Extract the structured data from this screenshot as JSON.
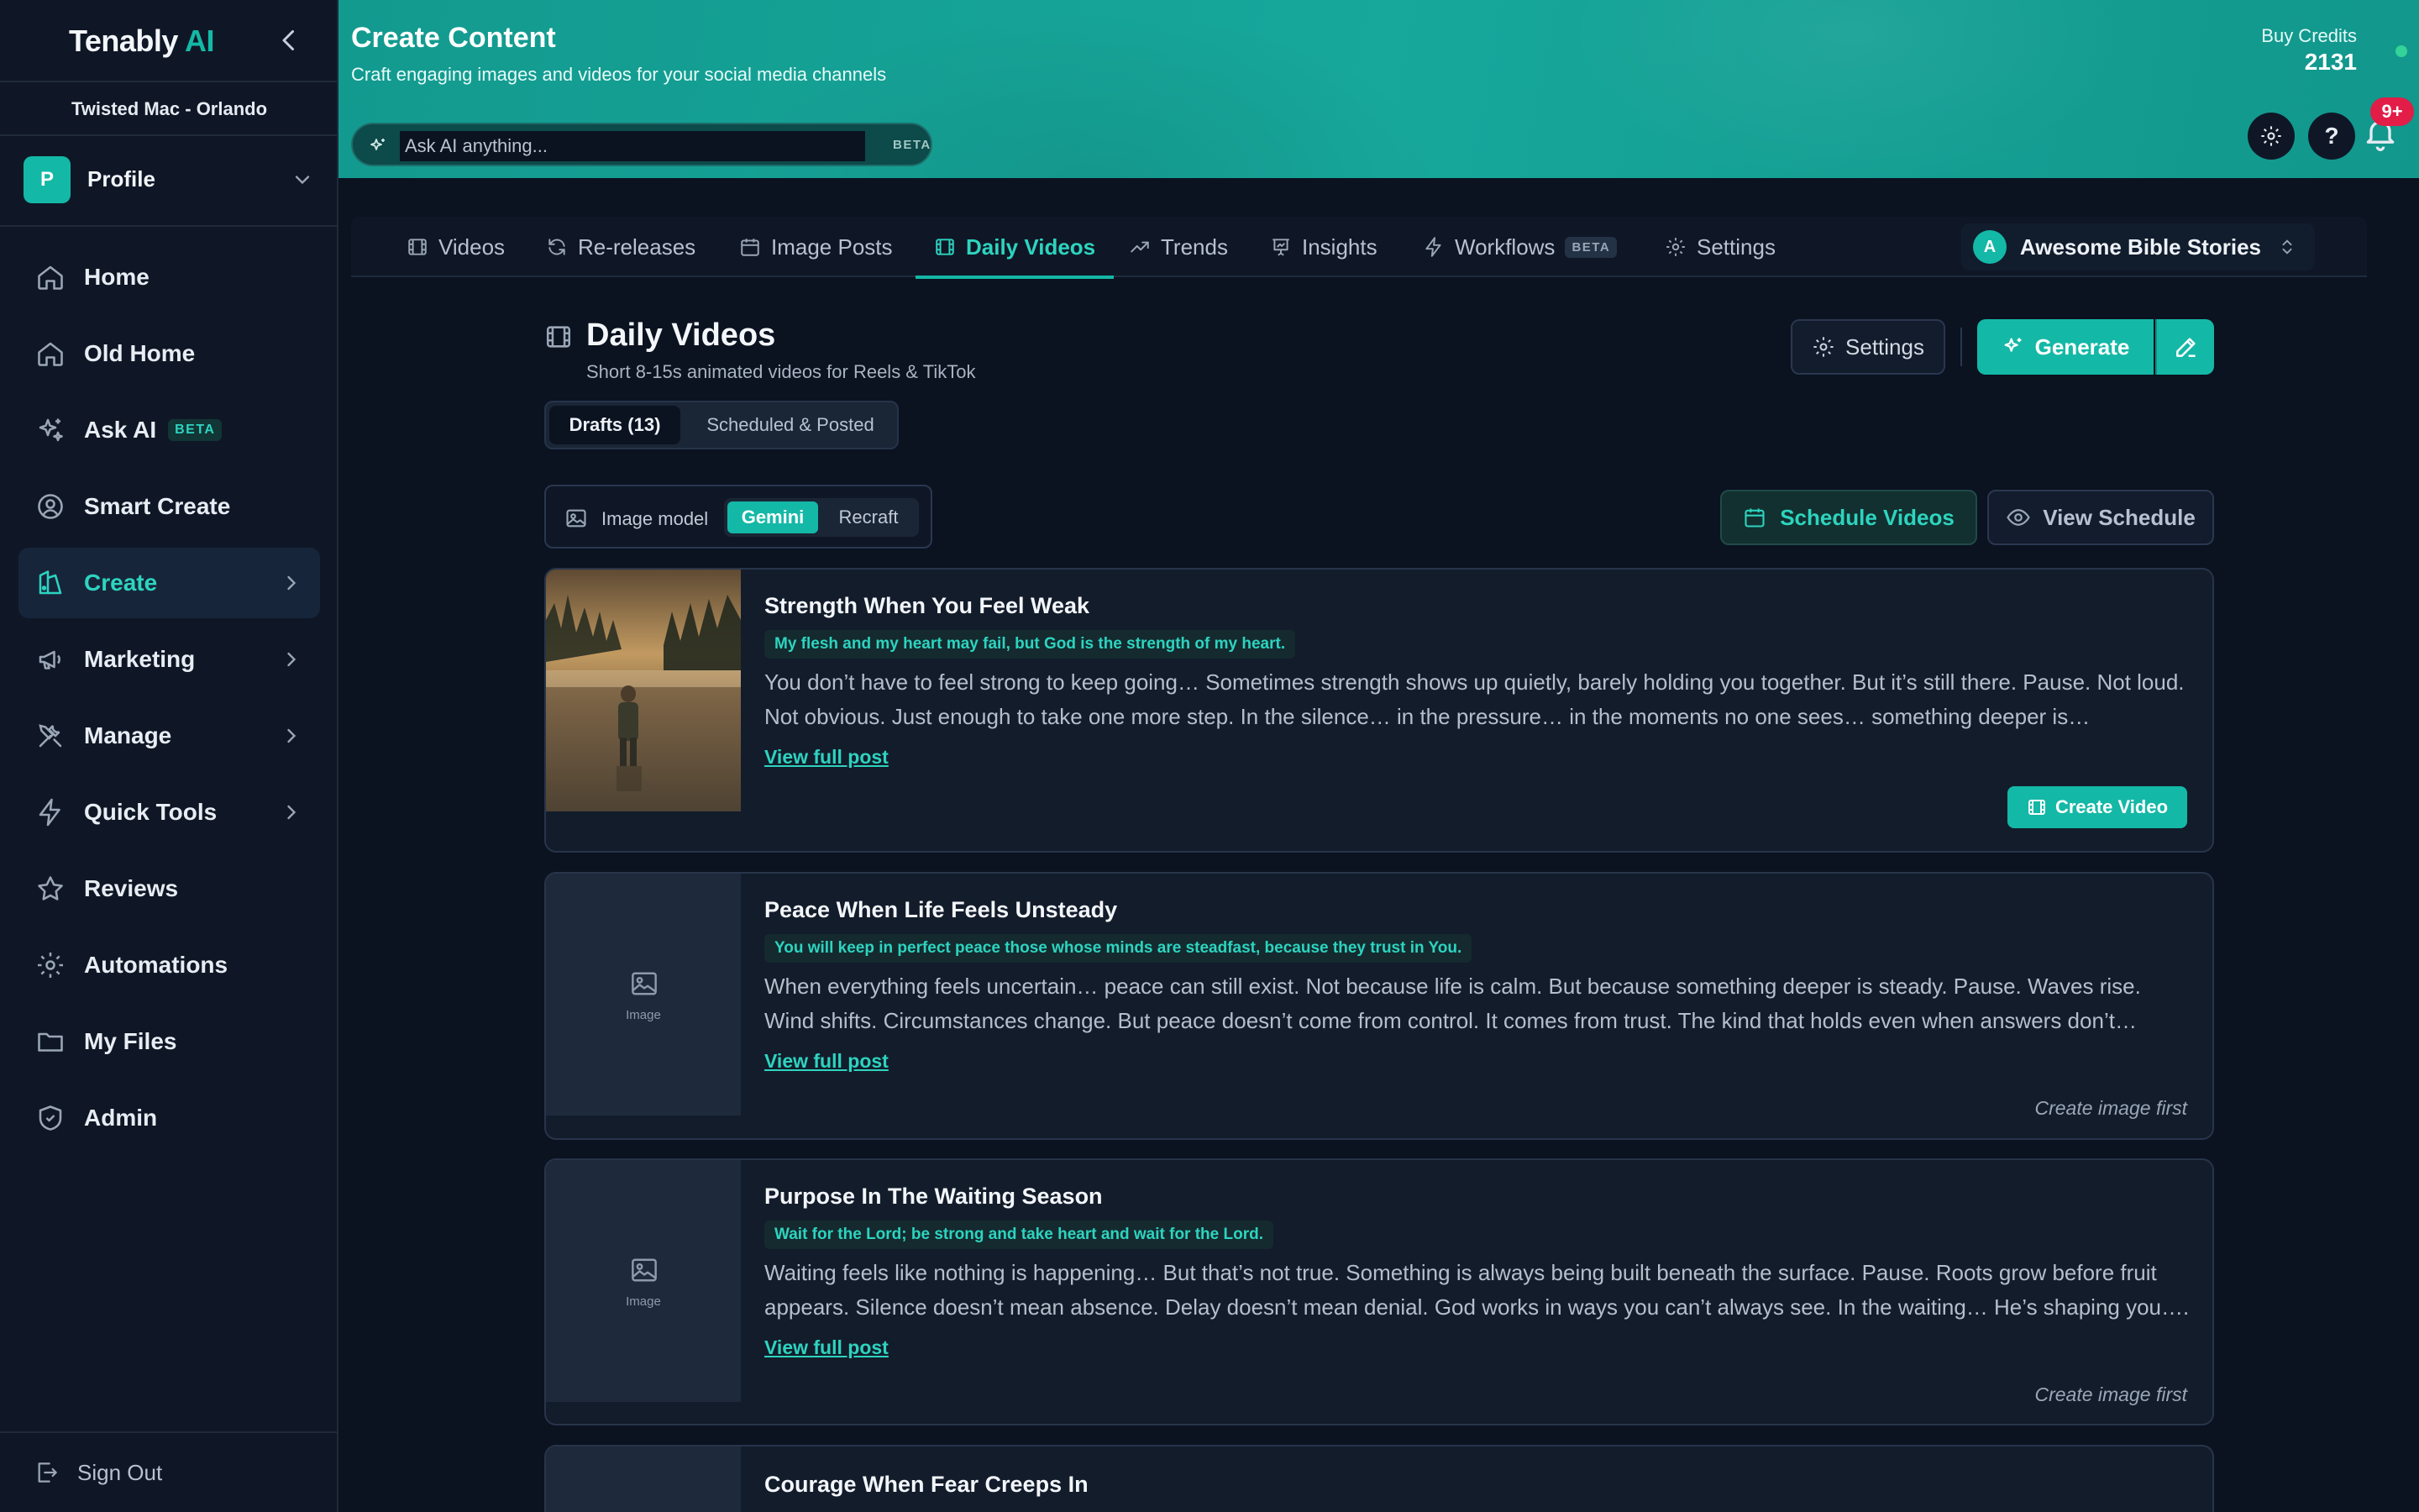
{
  "sidebar": {
    "brand": "Tenably",
    "brand_accent": " AI",
    "business": "Twisted Mac - Orlando",
    "profile_initial": "P",
    "profile_label": "Profile",
    "items": [
      {
        "label": "Home",
        "icon": "home-icon"
      },
      {
        "label": "Old Home",
        "icon": "home-icon"
      },
      {
        "label": "Ask AI",
        "icon": "sparkles-icon",
        "badge": "BETA"
      },
      {
        "label": "Smart Create",
        "icon": "user-circle-icon"
      },
      {
        "label": "Create",
        "icon": "paint-icon",
        "active": true
      },
      {
        "label": "Marketing",
        "icon": "megaphone-icon"
      },
      {
        "label": "Manage",
        "icon": "tools-icon"
      },
      {
        "label": "Quick Tools",
        "icon": "bolt-icon"
      },
      {
        "label": "Reviews",
        "icon": "star-icon"
      },
      {
        "label": "Automations",
        "icon": "gear-icon"
      },
      {
        "label": "My Files",
        "icon": "folder-icon"
      },
      {
        "label": "Admin",
        "icon": "shield-icon"
      }
    ],
    "sign_out": "Sign Out"
  },
  "header": {
    "title": "Create Content",
    "subtitle": "Craft engaging images and videos for your social media channels",
    "ask_placeholder": "Ask AI anything...",
    "ask_badge": "BETA",
    "credits_label": "Buy Credits",
    "credits_value": "2131",
    "notifications": "9+"
  },
  "tabs": [
    {
      "label": "Videos",
      "icon": "film-icon"
    },
    {
      "label": "Re-releases",
      "icon": "refresh-icon"
    },
    {
      "label": "Image Posts",
      "icon": "calendar-icon"
    },
    {
      "label": "Daily Videos",
      "icon": "film-icon",
      "active": true
    },
    {
      "label": "Trends",
      "icon": "trend-icon"
    },
    {
      "label": "Insights",
      "icon": "presentation-icon"
    },
    {
      "label": "Workflows",
      "icon": "bolt-icon",
      "badge": "BETA"
    },
    {
      "label": "Settings",
      "icon": "gear-icon"
    }
  ],
  "channel": {
    "initial": "A",
    "name": "Awesome Bible Stories"
  },
  "page": {
    "title": "Daily Videos",
    "subtitle": "Short 8-15s animated videos for Reels & TikTok",
    "settings_label": "Settings",
    "generate_label": "Generate",
    "subtabs": [
      "Drafts (13)",
      "Scheduled & Posted"
    ],
    "model_label": "Image model",
    "models": [
      "Gemini",
      "Recraft"
    ],
    "schedule_label": "Schedule Videos",
    "view_schedule_label": "View Schedule"
  },
  "cards": [
    {
      "title": "Strength When You Feel Weak",
      "verse": "My flesh and my heart may fail, but God is the strength of my heart.",
      "body": "You don’t have to feel strong to keep going… Sometimes strength shows up quietly, barely holding you together. But it’s still there. Pause. Not loud. Not obvious. Just enough to take one more step. In the silence… in the pressure… in the moments no one sees… something deeper is…",
      "link": "View full post",
      "action": "Create Video"
    },
    {
      "title": "Peace When Life Feels Unsteady",
      "verse": "You will keep in perfect peace those whose minds are steadfast, because they trust in You.",
      "body": "When everything feels uncertain… peace can still exist. Not because life is calm. But because something deeper is steady. Pause. Waves rise. Wind shifts. Circumstances change. But peace doesn’t come from control. It comes from trust. The kind that holds even when answers don’t…",
      "link": "View full post",
      "image_label": "Image",
      "note": "Create image first"
    },
    {
      "title": "Purpose In The Waiting Season",
      "verse": "Wait for the Lord; be strong and take heart and wait for the Lord.",
      "body": "Waiting feels like nothing is happening… But that’s not true. Something is always being built beneath the surface. Pause. Roots grow before fruit appears. Silence doesn’t mean absence. Delay doesn’t mean denial. God works in ways you can’t always see. In the waiting… He’s shaping you….",
      "link": "View full post",
      "image_label": "Image",
      "note": "Create image first"
    },
    {
      "title": "Courage When Fear Creeps In"
    }
  ],
  "colors": {
    "accent": "#14b8a6",
    "background": "#0b1220",
    "sidebar": "#0f1726",
    "badge": "#e11d48"
  }
}
